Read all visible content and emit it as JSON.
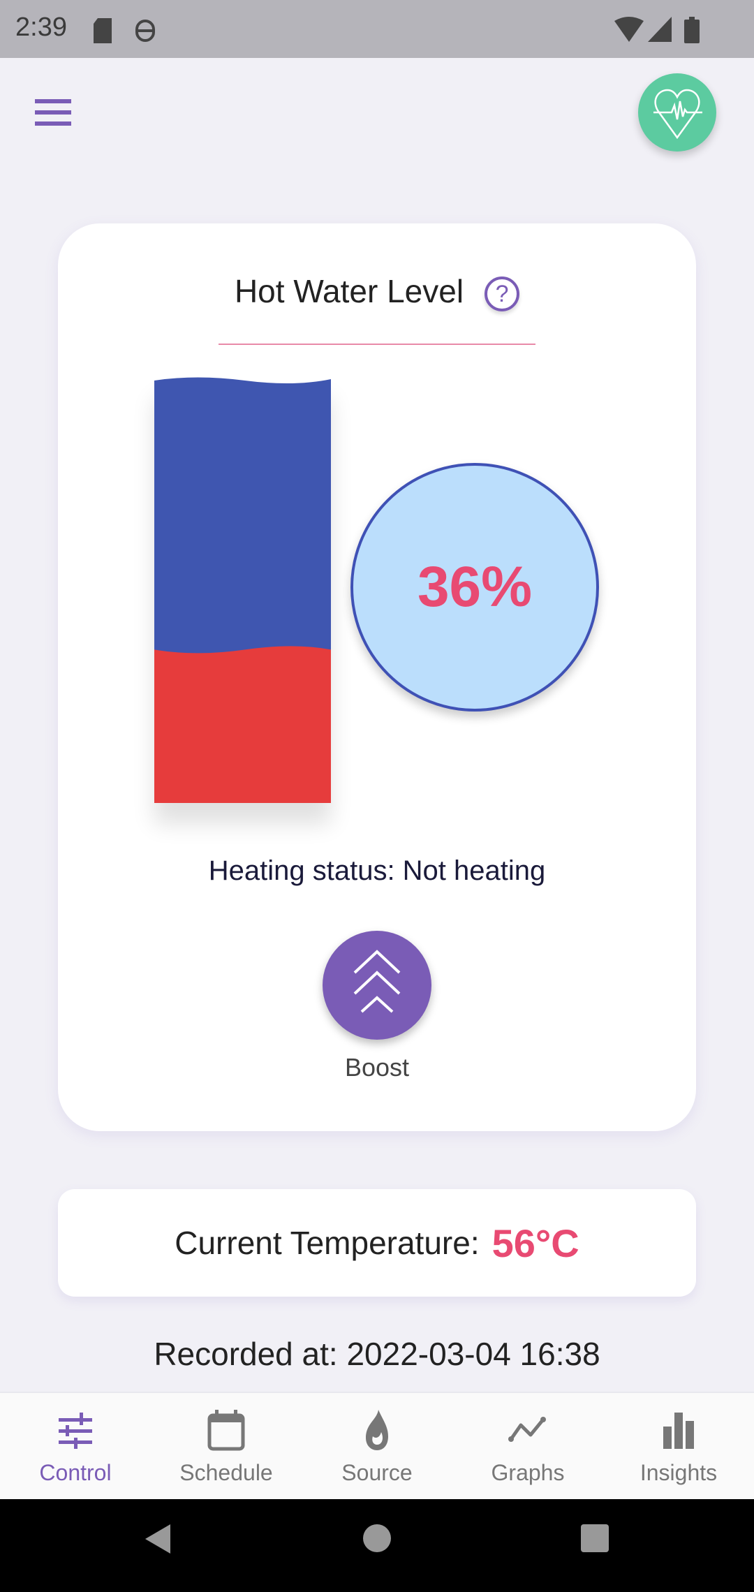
{
  "status_bar": {
    "time": "2:39",
    "icons": [
      "sd-card-icon",
      "robot-icon",
      "wifi-icon",
      "signal-icon",
      "battery-icon"
    ]
  },
  "header": {
    "menu_icon": "hamburger-menu-icon",
    "health_icon": "heart-pulse-icon"
  },
  "card": {
    "title": "Hot Water Level",
    "help_icon": "question-icon",
    "level_percent": 36,
    "level_label": "36%",
    "heating_status": "Heating status: Not heating",
    "boost_label": "Boost"
  },
  "temperature": {
    "label": "Current Temperature:",
    "value": "56°C"
  },
  "recorded": "Recorded at: 2022-03-04 16:38",
  "nav": {
    "items": [
      {
        "label": "Control",
        "icon": "sliders-icon",
        "active": true
      },
      {
        "label": "Schedule",
        "icon": "calendar-icon"
      },
      {
        "label": "Source",
        "icon": "flame-icon"
      },
      {
        "label": "Graphs",
        "icon": "line-graph-icon"
      },
      {
        "label": "Insights",
        "icon": "bar-chart-icon"
      }
    ]
  },
  "colors": {
    "accent": "#7a5cb6",
    "cold": "#3f51b5",
    "hot": "#e63c3c",
    "highlight": "#e84a72",
    "health": "#5ccba0"
  }
}
